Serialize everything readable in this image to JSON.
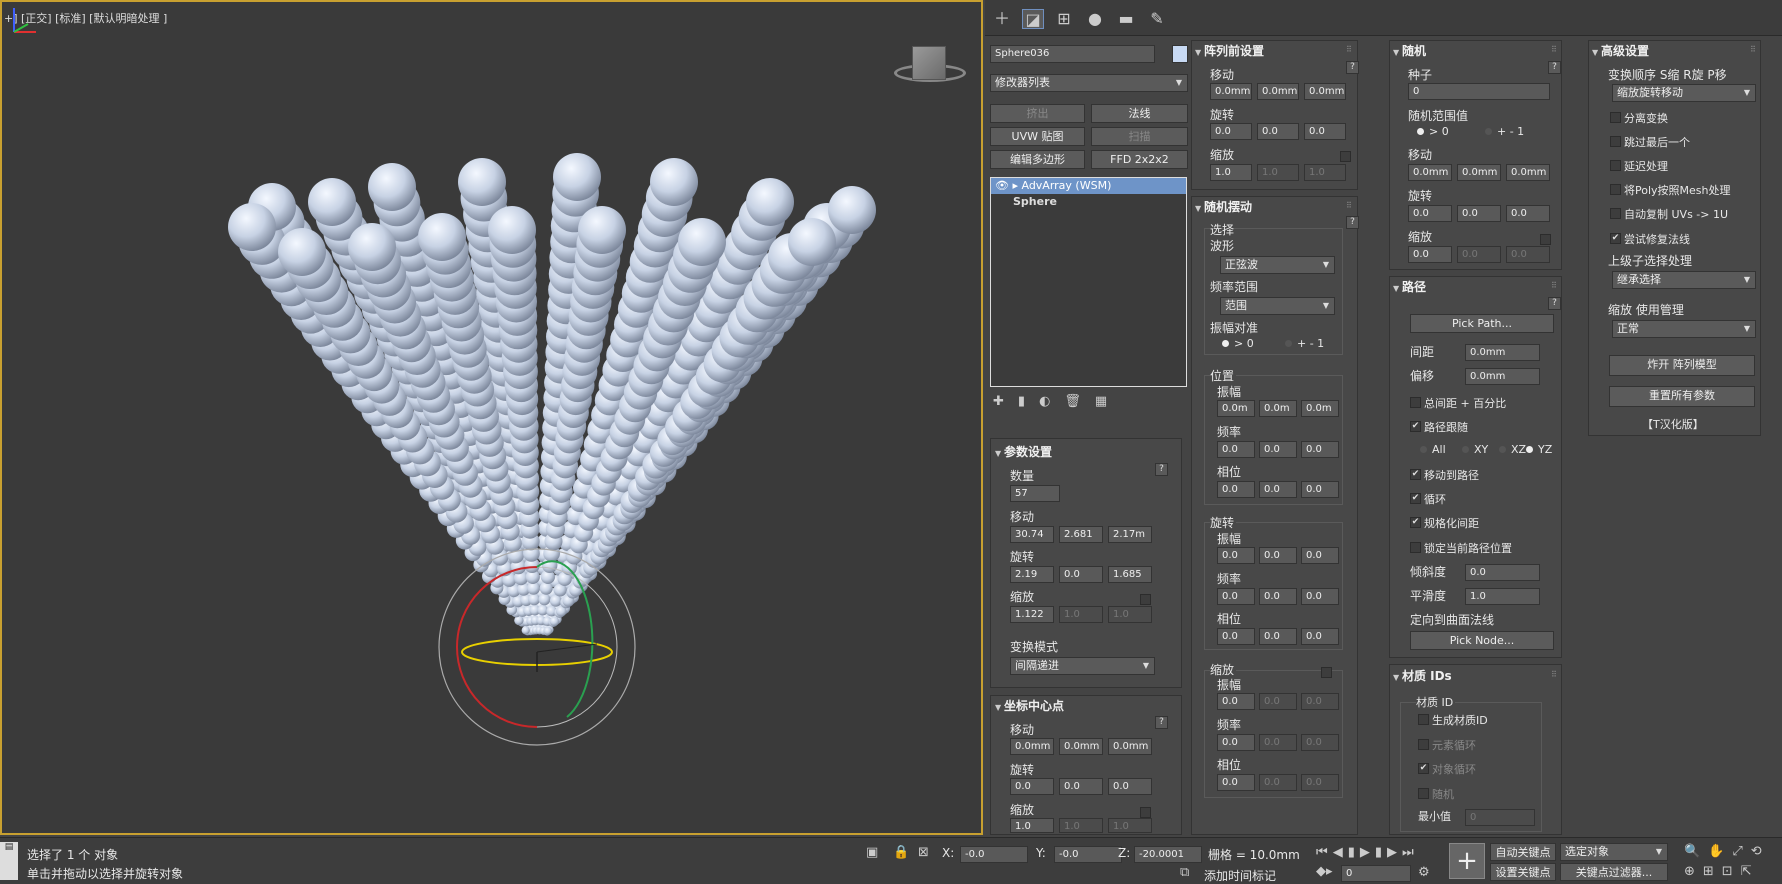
{
  "viewport": {
    "label": "+] [正交] [标准] [默认明暗处理 ]"
  },
  "toolbar": {
    "icons": [
      "plus-icon",
      "modify-icon",
      "hierarchy-icon",
      "motion-icon",
      "display-icon",
      "utilities-icon"
    ]
  },
  "object": {
    "name": "Sphere036",
    "modifier_list": "修改器列表",
    "buttons": [
      "挤出",
      "法线",
      "UVW 贴图",
      "扫描",
      "编辑多边形",
      "FFD 2x2x2"
    ],
    "stack": [
      "AdvArray (WSM)",
      "Sphere"
    ]
  },
  "params": {
    "title": "参数设置",
    "count_label": "数量",
    "count": "57",
    "move_label": "移动",
    "move": [
      "30.74",
      "2.681",
      "2.17m"
    ],
    "rotate_label": "旋转",
    "rotate": [
      "2.19",
      "0.0",
      "1.685"
    ],
    "scale_label": "缩放",
    "scale": [
      "1.122",
      "1.0",
      "1.0"
    ],
    "mode_label": "变换模式",
    "mode": "间隔递进"
  },
  "pivot": {
    "title": "坐标中心点",
    "move_label": "移动",
    "move": [
      "0.0mm",
      "0.0mm",
      "0.0mm"
    ],
    "rotate_label": "旋转",
    "rotate": [
      "0.0",
      "0.0",
      "0.0"
    ],
    "scale_label": "缩放",
    "scale": [
      "1.0",
      "1.0",
      "1.0"
    ]
  },
  "pre_array": {
    "title": "阵列前设置",
    "move_label": "移动",
    "move": [
      "0.0mm",
      "0.0mm",
      "0.0mm"
    ],
    "rotate_label": "旋转",
    "rotate": [
      "0.0",
      "0.0",
      "0.0"
    ],
    "scale_label": "缩放",
    "scale": [
      "1.0",
      "1.0",
      "1.0"
    ]
  },
  "jitter": {
    "title": "随机摆动",
    "select_label": "选择",
    "wave_label": "波形",
    "wave": "正弦波",
    "freq_label": "频率范围",
    "freq": "范围",
    "amp_label": "振幅对准",
    "amp_opt1": "> 0",
    "amp_opt2": "+ - 1",
    "pos_label": "位置",
    "rot_label": "旋转",
    "scl_label": "缩放",
    "amp": "振幅",
    "frq": "频率",
    "phase": "相位",
    "v3": [
      "0.0m",
      "0.0m",
      "0.0m"
    ],
    "v0": [
      "0.0",
      "0.0",
      "0.0"
    ]
  },
  "random": {
    "title": "随机",
    "seed_label": "种子",
    "seed": "0",
    "range_label": "随机范围值",
    "range_opt1": "> 0",
    "range_opt2": "+ - 1",
    "move_label": "移动",
    "move": [
      "0.0mm",
      "0.0mm",
      "0.0mm"
    ],
    "rotate_label": "旋转",
    "rotate": [
      "0.0",
      "0.0",
      "0.0"
    ],
    "scale_label": "缩放",
    "scale": [
      "0.0",
      "0.0",
      "0.0"
    ]
  },
  "path": {
    "title": "路径",
    "pick_path": "Pick Path...",
    "spacing_label": "间距",
    "spacing": "0.0mm",
    "offset_label": "偏移",
    "offset": "0.0mm",
    "total_dist": "总间距 + 百分比",
    "follow": "路径跟随",
    "axes": [
      "All",
      "XY",
      "XZ",
      "YZ"
    ],
    "move_to_path": "移动到路径",
    "loop": "循环",
    "normalize": "规格化间距",
    "lock": "锁定当前路径位置",
    "bank_label": "倾斜度",
    "bank": "0.0",
    "smooth_label": "平滑度",
    "smooth": "1.0",
    "orient_label": "定向到曲面法线",
    "pick_node": "Pick Node..."
  },
  "matid": {
    "title": "材质 IDs",
    "group": "材质 ID",
    "gen": "生成材质ID",
    "elem": "元素循环",
    "obj": "对象循环",
    "rand": "随机",
    "min_label": "最小值",
    "min": "0"
  },
  "advanced": {
    "title": "高级设置",
    "order_label": "变换顺序 S缩 R旋 P移",
    "order": "缩放旋转移动",
    "opt1": "分离变换",
    "opt2": "跳过最后一个",
    "opt3": "延迟处理",
    "opt4": "将Poly按照Mesh处理",
    "opt5": "自动复制 UVs -> 1U",
    "opt6": "尝试修复法线",
    "parent_label": "上级子选择处理",
    "parent": "继承选择",
    "scale_mgr_label": "缩放 使用管理",
    "scale_mgr": "正常",
    "explode_btn": "炸开 阵列模型",
    "reset_btn": "重置所有参数",
    "credit": "【T汉化版】"
  },
  "status": {
    "msg1": "选择了 1 个 对象",
    "msg2": "单击并拖动以选择并旋转对象",
    "x_label": "X:",
    "x": "-0.0",
    "y_label": "Y:",
    "y": "-0.0",
    "z_label": "Z:",
    "z": "-20.0001",
    "grid_label": "栅格 = 10.0mm",
    "add_tag": "添加时间标记",
    "frame": "0",
    "auto_key": "自动关键点",
    "set_key": "设置关键点",
    "sel_obj": "选定对象",
    "key_filter": "关键点过滤器..."
  },
  "colors": {
    "accent": "#6e94c8",
    "viewport_border": "#c8a030",
    "sphere": "#c8d4e8"
  }
}
